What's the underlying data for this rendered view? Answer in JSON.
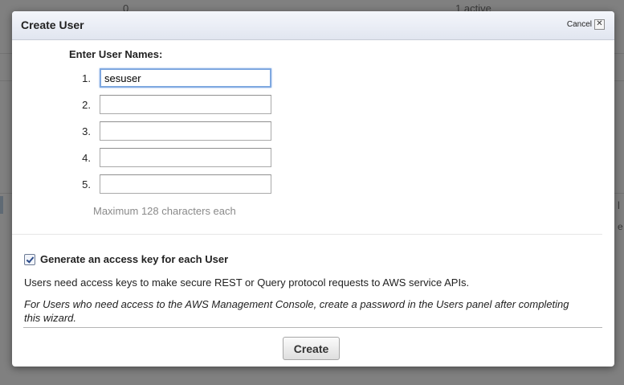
{
  "background": {
    "col1_value": "0",
    "col2_value": "1 active",
    "sidebar_fragment_1": "l",
    "sidebar_fragment_2": "e"
  },
  "dialog": {
    "title": "Create User",
    "cancel_label": "Cancel",
    "close_icon": "close-icon",
    "section_title": "Enter User Names:",
    "rows": [
      {
        "number": "1.",
        "value": "sesuser"
      },
      {
        "number": "2.",
        "value": ""
      },
      {
        "number": "3.",
        "value": ""
      },
      {
        "number": "4.",
        "value": ""
      },
      {
        "number": "5.",
        "value": ""
      }
    ],
    "hint": "Maximum 128 characters each",
    "checkbox": {
      "label": "Generate an access key for each User",
      "checked": true
    },
    "info_text": "Users need access keys to make secure REST or Query protocol requests to AWS service APIs.",
    "note_text": "For Users who need access to the AWS Management Console, create a password in the Users panel after completing this wizard.",
    "create_label": "Create"
  }
}
